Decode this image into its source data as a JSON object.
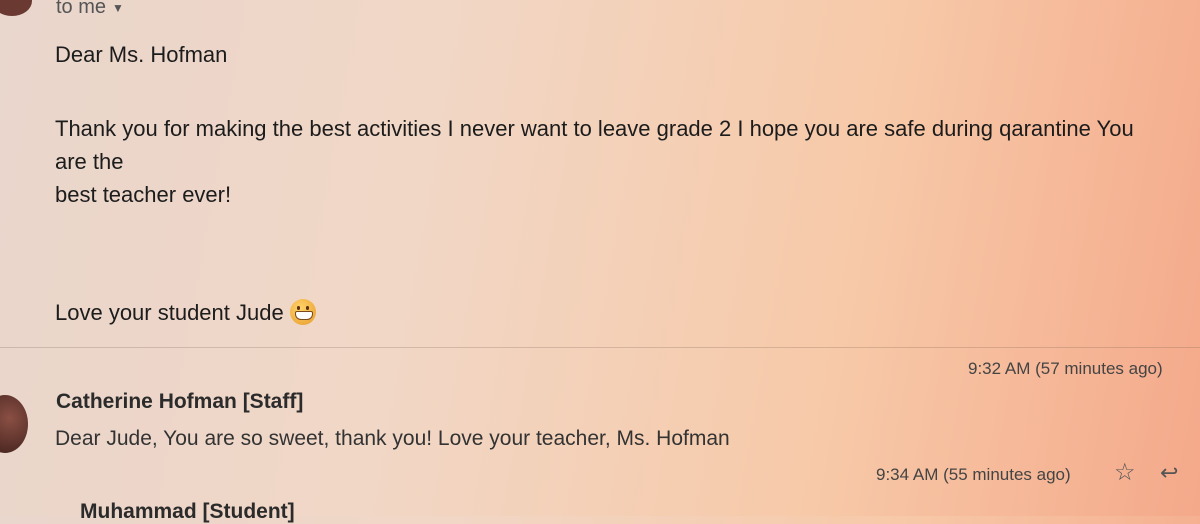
{
  "header": {
    "to_label": "to me",
    "caret_icon": "chevron-down-icon"
  },
  "message1": {
    "greeting": "Dear Ms. Hofman",
    "body_line1": "Thank you for making the best activities I never want to leave grade 2 I hope you are safe during qarantine You",
    "body_line2": "are the",
    "body_line3": "best teacher ever!",
    "signoff": "Love your student Jude",
    "emoji": "grinning-face-emoji"
  },
  "message2": {
    "sender": "Catherine Hofman [Staff]",
    "time": "9:32 AM (57 minutes ago)",
    "snippet": "Dear Jude, You are so sweet, thank you! Love your teacher, Ms. Hofman"
  },
  "message3": {
    "sender_partial": "Muhammad [Student]",
    "time": "9:34 AM (55 minutes ago)",
    "star_icon": "star-icon",
    "reply_icon": "reply-icon"
  }
}
